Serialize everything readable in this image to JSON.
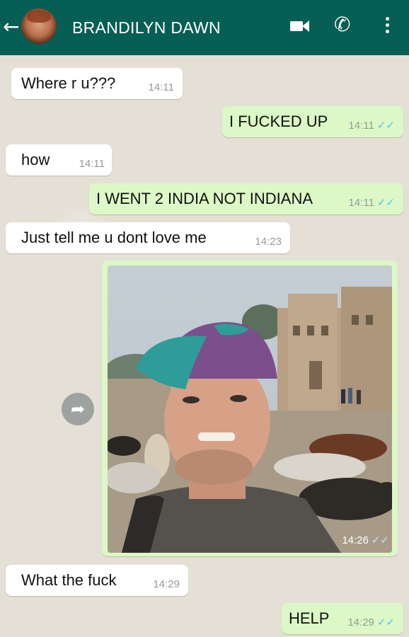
{
  "header": {
    "contact_name": "BRANDILYN DAWN",
    "back_icon": "arrow-left-icon",
    "video_icon": "video-call-icon",
    "phone_icon": "phone-icon",
    "menu_icon": "more-vert-icon",
    "background_color": "#075e54"
  },
  "messages": [
    {
      "direction": "in",
      "text": "Where r u???",
      "time": "14:11"
    },
    {
      "direction": "out",
      "text": "I FUCKED UP",
      "time": "14:11",
      "read": true
    },
    {
      "direction": "in",
      "text": "how",
      "time": "14:11"
    },
    {
      "direction": "out",
      "text": "I WENT 2 INDIA NOT INDIANA",
      "time": "14:11",
      "read": true
    },
    {
      "direction": "in",
      "text": "Just tell me u dont love me",
      "time": "14:23"
    },
    {
      "direction": "out",
      "type": "image",
      "description_icon": "selfie-photo",
      "time": "14:26",
      "read": true
    },
    {
      "direction": "in",
      "text": "What the fuck",
      "time": "14:29"
    },
    {
      "direction": "out",
      "text": "HELP",
      "time": "14:29",
      "read": true
    }
  ],
  "ticks_glyph": "✓✓",
  "colors": {
    "incoming_bubble": "#ffffff",
    "outgoing_bubble": "#dcf8c6",
    "read_ticks": "#4fc3f7"
  }
}
